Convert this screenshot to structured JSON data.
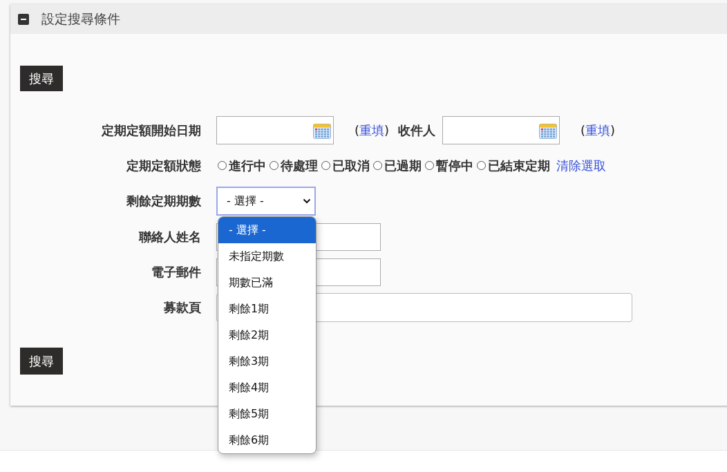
{
  "panel": {
    "title": "設定搜尋條件",
    "expanded": true
  },
  "top_button": "搜尋",
  "fields": [
    {
      "kind": "date",
      "label": "定期定額開始日期",
      "reset": {
        "open": "(",
        "link": "重填",
        "close": ")"
      },
      "second_label": "收件人",
      "second_reset": {
        "open": "(",
        "link": "重填",
        "close": ")"
      }
    },
    {
      "kind": "radio",
      "label": "定期定額狀態",
      "options": [
        {
          "label": "進行中",
          "selected": false
        },
        {
          "label": "待處理",
          "selected": false
        },
        {
          "label": "已取消",
          "selected": false
        },
        {
          "label": "已過期",
          "selected": false
        },
        {
          "label": "暫停中",
          "selected": false
        },
        {
          "label": "已結束定期",
          "selected": false
        }
      ],
      "clear_link": "清除選取"
    },
    {
      "kind": "select",
      "label": "剩餘定期期數",
      "value": "- 選擇 -",
      "expanded": true,
      "options": [
        {
          "label": "- 選擇 -",
          "selected": true
        },
        {
          "label": "未指定期數",
          "selected": false
        },
        {
          "label": "期數已滿",
          "selected": false
        },
        {
          "label": "剩餘1期",
          "selected": false
        },
        {
          "label": "剩餘2期",
          "selected": false
        },
        {
          "label": "剩餘3期",
          "selected": false
        },
        {
          "label": "剩餘4期",
          "selected": false
        },
        {
          "label": "剩餘5期",
          "selected": false
        },
        {
          "label": "剩餘6期",
          "selected": false
        }
      ]
    },
    {
      "kind": "text",
      "label": "聯絡人姓名"
    },
    {
      "kind": "text",
      "label": "電子郵件"
    },
    {
      "kind": "wide_text",
      "label": "募款頁"
    }
  ],
  "bottom_button": "搜尋"
}
